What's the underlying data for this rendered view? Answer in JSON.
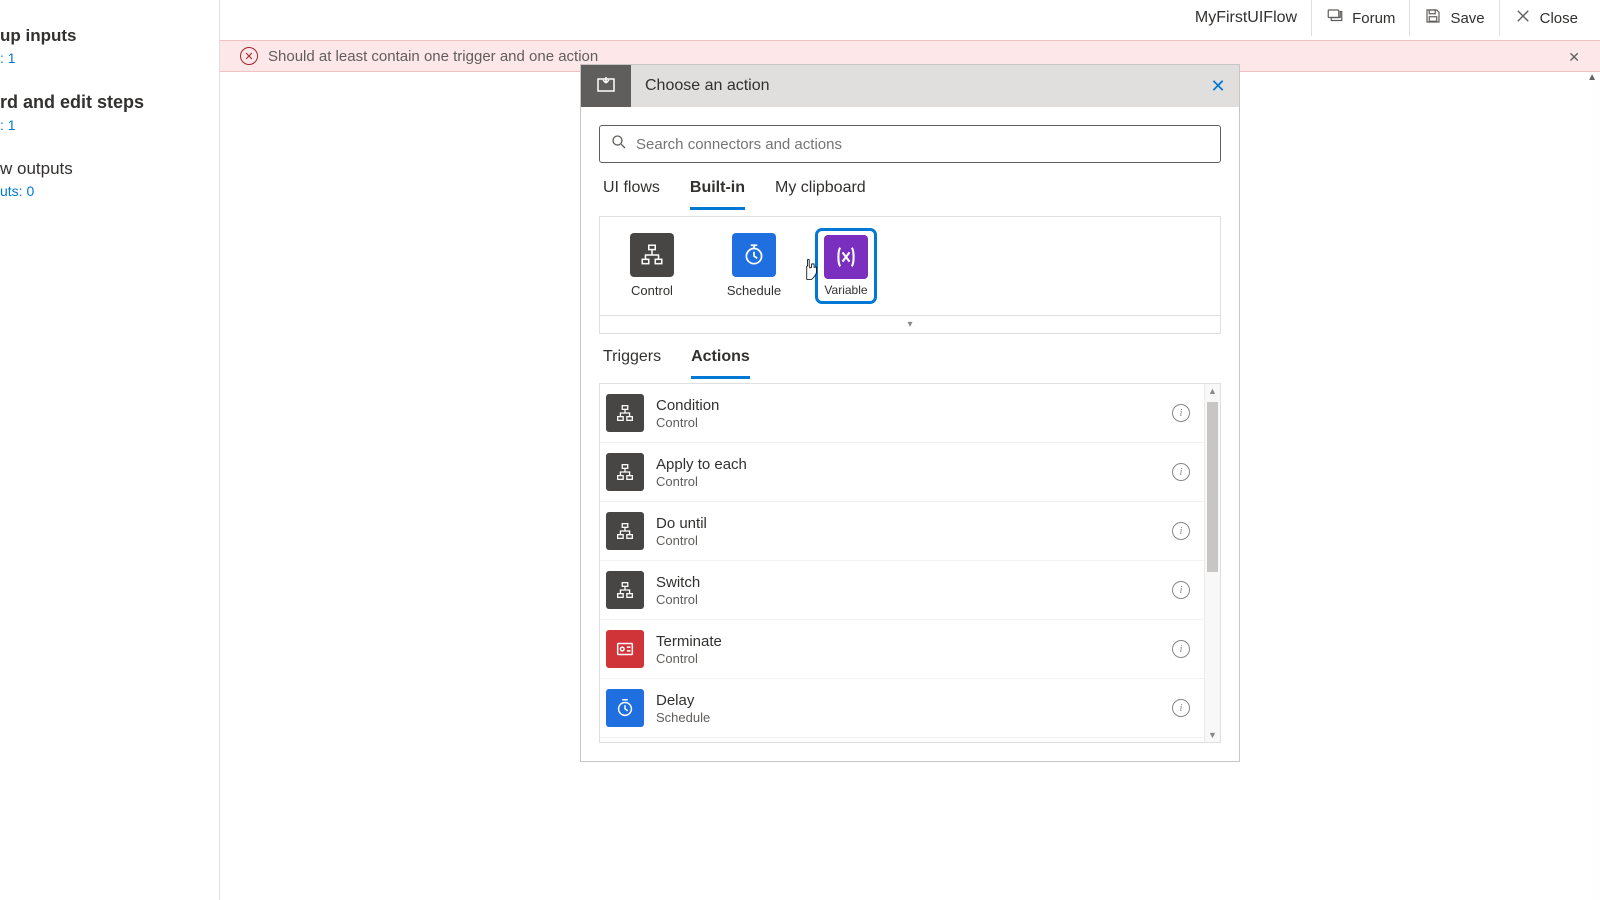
{
  "topbar": {
    "title": "MyFirstUIFlow",
    "forum": "Forum",
    "save": "Save",
    "close": "Close"
  },
  "sidebar": {
    "item0": {
      "title": "up inputs",
      "sub": ": 1"
    },
    "item1": {
      "title": "rd and edit steps",
      "sub": ": 1"
    },
    "item2": {
      "title": "w outputs",
      "sub": "uts: 0"
    }
  },
  "banner": {
    "text": "Should at least contain one trigger and one action"
  },
  "picker": {
    "title": "Choose an action",
    "search_placeholder": "Search connectors and actions",
    "tabs1": {
      "uiflows": "UI flows",
      "builtin": "Built-in",
      "clipboard": "My clipboard"
    },
    "tiles": {
      "control": "Control",
      "schedule": "Schedule",
      "variable": "Variable"
    },
    "tabs2": {
      "triggers": "Triggers",
      "actions": "Actions"
    },
    "list": [
      {
        "name": "Condition",
        "cat": "Control",
        "icon": "ctrl"
      },
      {
        "name": "Apply to each",
        "cat": "Control",
        "icon": "ctrl"
      },
      {
        "name": "Do until",
        "cat": "Control",
        "icon": "ctrl"
      },
      {
        "name": "Switch",
        "cat": "Control",
        "icon": "ctrl"
      },
      {
        "name": "Terminate",
        "cat": "Control",
        "icon": "term"
      },
      {
        "name": "Delay",
        "cat": "Schedule",
        "icon": "sched"
      }
    ]
  }
}
